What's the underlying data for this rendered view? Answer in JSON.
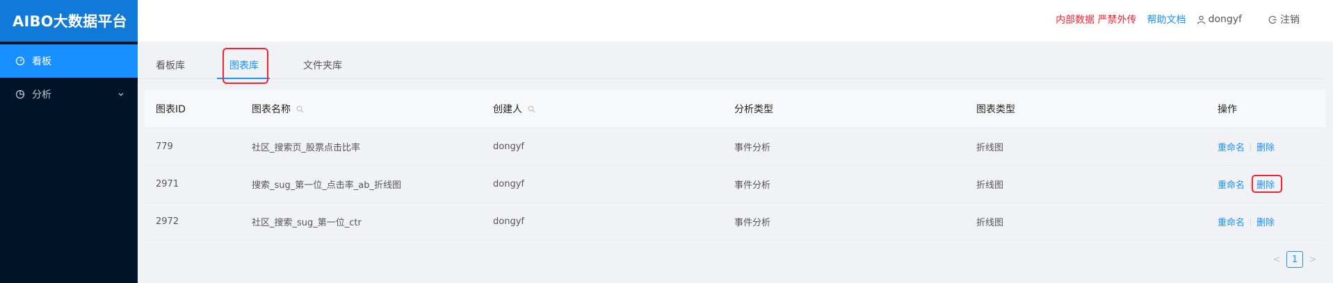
{
  "app": {
    "title": "AIBO大数据平台"
  },
  "sidebar": {
    "items": [
      {
        "label": "看板",
        "icon": "dashboard-icon"
      },
      {
        "label": "分析",
        "icon": "pie-chart-icon"
      }
    ]
  },
  "header": {
    "warning": "内部数据 严禁外传",
    "help": "帮助文档",
    "user": "dongyf",
    "logout": "注销"
  },
  "tabs": [
    {
      "label": "看板库"
    },
    {
      "label": "图表库"
    },
    {
      "label": "文件夹库"
    }
  ],
  "table": {
    "columns": [
      "图表ID",
      "图表名称",
      "创建人",
      "分析类型",
      "图表类型",
      "操作"
    ],
    "rows": [
      {
        "id": "779",
        "name": "社区_搜索页_股票点击比率",
        "creator": "dongyf",
        "analysis": "事件分析",
        "chart": "折线图"
      },
      {
        "id": "2971",
        "name": "搜索_sug_第一位_点击率_ab_折线图",
        "creator": "dongyf",
        "analysis": "事件分析",
        "chart": "折线图"
      },
      {
        "id": "2972",
        "name": "社区_搜索_sug_第一位_ctr",
        "creator": "dongyf",
        "analysis": "事件分析",
        "chart": "折线图"
      }
    ],
    "actions": {
      "rename": "重命名",
      "delete": "删除"
    }
  },
  "pagination": {
    "current": "1",
    "prev": "<",
    "next": ">"
  },
  "colors": {
    "accent": "#1890ff",
    "sidebar": "#001529",
    "logo": "#1179d8",
    "warning": "#f5222d"
  }
}
